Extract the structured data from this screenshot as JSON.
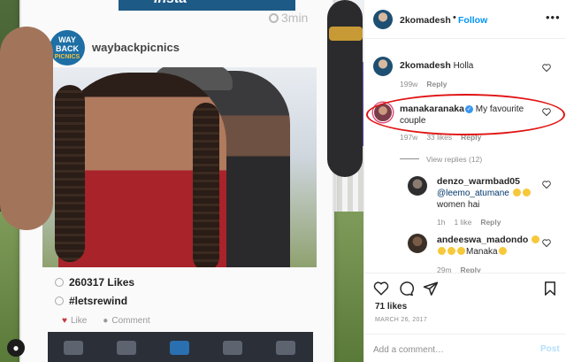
{
  "photo": {
    "frame_banner": "Insta",
    "frame_time": "3min",
    "frame_logo_line1": "WAY BACK",
    "frame_logo_line2": "PICNICS",
    "frame_handle": "waybackpicnics",
    "frame_likes": "260317 Likes",
    "frame_tag": "#letsrewind",
    "frame_like": "Like",
    "frame_comment": "Comment"
  },
  "header": {
    "username": "2komadesh",
    "separator": "•",
    "follow_label": "Follow",
    "more": "•••"
  },
  "comments": [
    {
      "username": "2komadesh",
      "text": "Holla",
      "time": "199w",
      "reply": "Reply"
    },
    {
      "username": "manakaranaka",
      "verified": "✓",
      "text": "My favourite couple",
      "time": "197w",
      "likes": "33 likes",
      "reply": "Reply"
    }
  ],
  "view_replies": "View replies (12)",
  "replies": [
    {
      "username": "denzo_warmbad05",
      "mention": "@leemo_atumane",
      "text": "women hai",
      "time": "1h",
      "likes": "1 like",
      "reply": "Reply"
    },
    {
      "username": "andeeswa_madondo",
      "text": "Manaka",
      "time": "29m",
      "reply": "Reply"
    }
  ],
  "actions": {
    "likes": "71 likes",
    "date": "MARCH 26, 2017",
    "add_comment_placeholder": "Add a comment…",
    "post_label": "Post"
  },
  "colors": {
    "link": "#0095f6",
    "highlight_oval": "#e01313",
    "post_disabled": "#b2dffc"
  }
}
